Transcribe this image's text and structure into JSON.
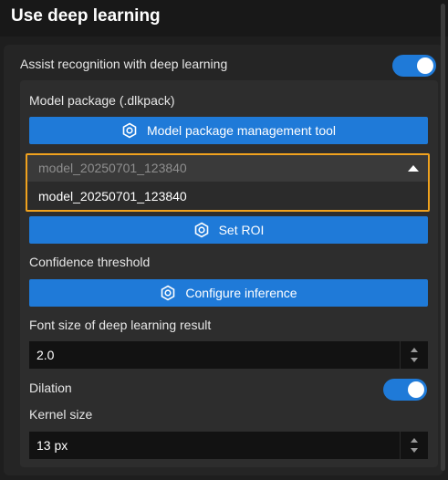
{
  "title": "Use deep learning",
  "assist": {
    "label": "Assist recognition with deep learning",
    "enabled": true
  },
  "model_package": {
    "label": "Model package (.dlkpack)",
    "management_button": "Model package management tool",
    "selected": "model_20250701_123840",
    "options": [
      "model_20250701_123840"
    ]
  },
  "set_roi_button": "Set ROI",
  "confidence": {
    "label": "Confidence threshold",
    "configure_button": "Configure inference"
  },
  "font_size": {
    "label": "Font size of deep learning result",
    "value": "2.0"
  },
  "dilation": {
    "label": "Dilation",
    "enabled": true
  },
  "kernel": {
    "label": "Kernel size",
    "value": "13 px"
  },
  "colors": {
    "accent": "#1f7ad8",
    "highlight": "#f0a21e",
    "background": "#1e1e1e"
  },
  "icons": {
    "button_icon": "settings-hexagon-icon"
  }
}
